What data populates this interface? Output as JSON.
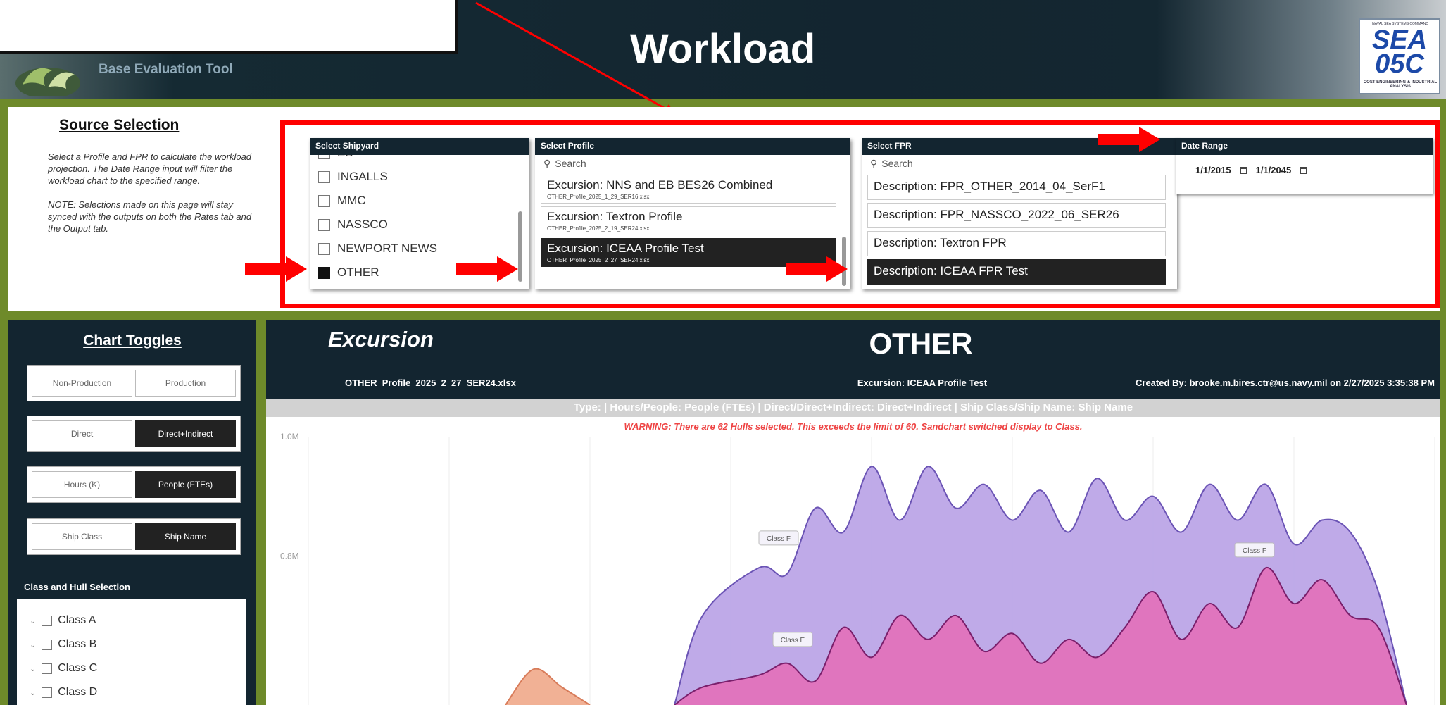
{
  "header": {
    "app_subtitle": "Base Evaluation Tool",
    "title": "Workload",
    "logo": {
      "top_text": "NAVAL SEA SYSTEMS COMMAND",
      "main_text": "SEA 05C",
      "bottom_text": "COST ENGINEERING & INDUSTRIAL ANALYSIS"
    }
  },
  "source_selection": {
    "title": "Source Selection",
    "description": "Select a Profile and FPR to calculate the workload projection. The Date Range input will filter the workload chart to the specified range.",
    "note": "NOTE: Selections made on this page will stay synced with the outputs on both the Rates tab and the Output tab.",
    "shipyard": {
      "title": "Select Shipyard",
      "items": [
        {
          "label": "EB",
          "checked": false
        },
        {
          "label": "INGALLS",
          "checked": false
        },
        {
          "label": "MMC",
          "checked": false
        },
        {
          "label": "NASSCO",
          "checked": false
        },
        {
          "label": "NEWPORT NEWS",
          "checked": false
        },
        {
          "label": "OTHER",
          "checked": true
        }
      ]
    },
    "profile": {
      "title": "Select Profile",
      "search_placeholder": "Search",
      "items": [
        {
          "label": "Excursion: NNS and EB BES26 Combined",
          "file": "OTHER_Profile_2025_1_29_SER16.xlsx",
          "selected": false
        },
        {
          "label": "Excursion: Textron Profile",
          "file": "OTHER_Profile_2025_2_19_SER24.xlsx",
          "selected": false
        },
        {
          "label": "Excursion: ICEAA Profile Test",
          "file": "OTHER_Profile_2025_2_27_SER24.xlsx",
          "selected": true
        }
      ]
    },
    "fpr": {
      "title": "Select FPR",
      "search_placeholder": "Search",
      "items": [
        {
          "label": "Description: FPR_OTHER_2014_04_SerF1",
          "selected": false
        },
        {
          "label": "Description: FPR_NASSCO_2022_06_SER26",
          "selected": false
        },
        {
          "label": "Description: Textron FPR",
          "selected": false
        },
        {
          "label": "Description: ICEAA FPR Test",
          "selected": true
        }
      ]
    },
    "date_range": {
      "title": "Date Range",
      "start": "1/1/2015",
      "end": "1/1/2045"
    }
  },
  "toggles": {
    "title": "Chart Toggles",
    "groups": [
      {
        "options": [
          "Non-Production",
          "Production"
        ],
        "active": -1
      },
      {
        "options": [
          "Direct",
          "Direct+Indirect"
        ],
        "active": 1
      },
      {
        "options": [
          "Hours (K)",
          "People (FTEs)"
        ],
        "active": 1
      },
      {
        "options": [
          "Ship Class",
          "Ship Name"
        ],
        "active": 1
      }
    ],
    "hull_selection": {
      "title": "Class and Hull Selection",
      "items": [
        "Class A",
        "Class B",
        "Class C",
        "Class D"
      ]
    }
  },
  "chart_header": {
    "excursion_label": "Excursion",
    "shipyard": "OTHER",
    "file": "OTHER_Profile_2025_2_27_SER24.xlsx",
    "profile": "Excursion: ICEAA Profile Test",
    "created_by": "Created By: brooke.m.bires.ctr@us.navy.mil on 2/27/2025 3:35:38 PM",
    "filter_summary": "Type: | Hours/People: People (FTEs) | Direct/Direct+Indirect: Direct+Indirect | Ship Class/Ship Name: Ship Name",
    "warning": "WARNING: There are 62 Hulls selected. This exceeds the limit of 60. Sandchart switched display to Class."
  },
  "chart_data": {
    "type": "area",
    "stacked": true,
    "ylabels": [
      "1.0M",
      "0.8M"
    ],
    "ylim": [
      0.55,
      1.0
    ],
    "xlim": [
      0,
      40
    ],
    "grid": true,
    "series": [
      {
        "name": "Class E",
        "color": "#e36fb9",
        "line": "#7a1f6b",
        "x": [
          13,
          14,
          16,
          17,
          18,
          19,
          20,
          21,
          22,
          23,
          24,
          25,
          26,
          27,
          28,
          29,
          30,
          31,
          32,
          33,
          34,
          35,
          36,
          37,
          38,
          39
        ],
        "values": [
          0.55,
          0.58,
          0.6,
          0.62,
          0.59,
          0.68,
          0.63,
          0.7,
          0.66,
          0.7,
          0.64,
          0.67,
          0.62,
          0.66,
          0.63,
          0.68,
          0.74,
          0.66,
          0.72,
          0.68,
          0.78,
          0.72,
          0.76,
          0.7,
          0.68,
          0.55
        ]
      },
      {
        "name": "Class F",
        "color": "#b8a1e6",
        "line": "#6b54b5",
        "x": [
          13,
          14,
          16,
          17,
          18,
          19,
          20,
          21,
          22,
          23,
          24,
          25,
          26,
          27,
          28,
          29,
          30,
          31,
          32,
          33,
          34,
          35,
          36,
          37,
          38,
          39
        ],
        "values": [
          0.55,
          0.7,
          0.78,
          0.77,
          0.88,
          0.84,
          0.95,
          0.86,
          0.95,
          0.88,
          0.92,
          0.86,
          0.91,
          0.84,
          0.93,
          0.86,
          0.9,
          0.84,
          0.92,
          0.86,
          0.92,
          0.82,
          0.86,
          0.84,
          0.74,
          0.55
        ]
      },
      {
        "name": "",
        "color": "#f0a98a",
        "line": "#d87c5a",
        "x": [
          7,
          8,
          9,
          10
        ],
        "values": [
          0.55,
          0.61,
          0.58,
          0.55
        ]
      }
    ],
    "annotations": [
      {
        "text": "Class F",
        "x": 16.7,
        "y": 0.83
      },
      {
        "text": "Class F",
        "x": 33.6,
        "y": 0.81
      },
      {
        "text": "Class E",
        "x": 17.2,
        "y": 0.66
      }
    ]
  }
}
